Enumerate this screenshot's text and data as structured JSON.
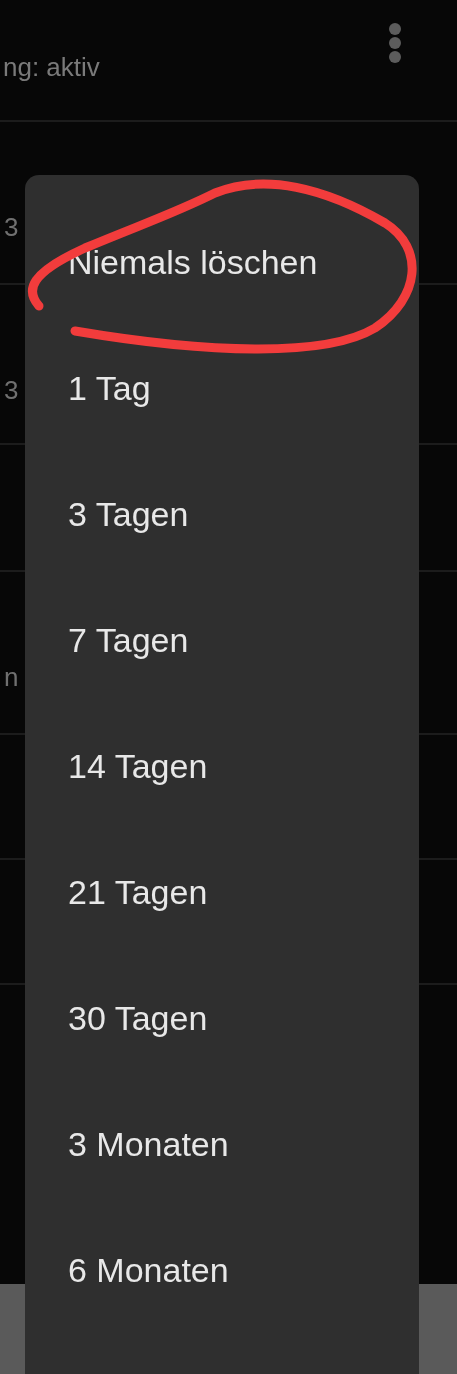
{
  "header": {
    "subtitle": "ng: aktiv"
  },
  "rows": [
    {
      "text": "3"
    },
    {
      "text": "3"
    },
    {},
    {
      "text": "n"
    },
    {},
    {}
  ],
  "menu": {
    "items": [
      {
        "label": "Niemals löschen",
        "circled": true
      },
      {
        "label": "1 Tag",
        "circled": false
      },
      {
        "label": "3 Tagen",
        "circled": false
      },
      {
        "label": "7 Tagen",
        "circled": false
      },
      {
        "label": "14 Tagen",
        "circled": false
      },
      {
        "label": "21 Tagen",
        "circled": false
      },
      {
        "label": "30 Tagen",
        "circled": false
      },
      {
        "label": "3 Monaten",
        "circled": false
      },
      {
        "label": "6 Monaten",
        "circled": false
      }
    ]
  }
}
